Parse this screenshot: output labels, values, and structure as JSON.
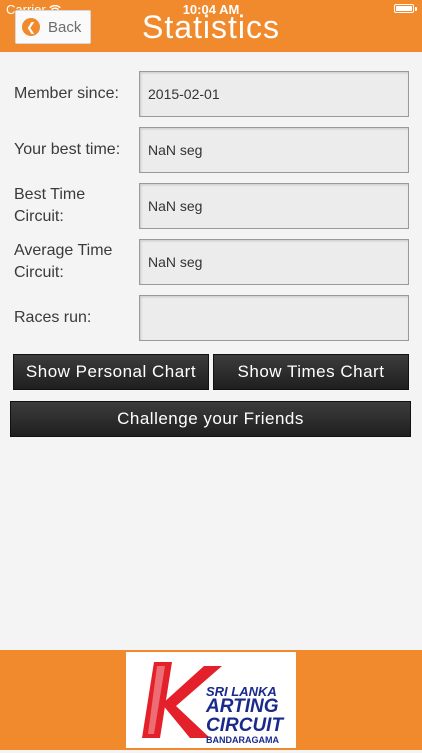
{
  "status_bar": {
    "carrier": "Carrier",
    "time": "10:04 AM"
  },
  "header": {
    "back_label": "Back",
    "title": "Statistics",
    "accent_color": "#f08a2c"
  },
  "fields": [
    {
      "label": "Member since:",
      "value": "2015-02-01"
    },
    {
      "label": "Your best time:",
      "value": "NaN seg"
    },
    {
      "label": "Best Time Circuit:",
      "value": "NaN seg"
    },
    {
      "label": "Average Time Circuit:",
      "value": "NaN seg"
    },
    {
      "label": "Races run:",
      "value": ""
    }
  ],
  "buttons": {
    "personal_chart": "Show Personal Chart",
    "times_chart": "Show Times Chart",
    "challenge": "Challenge your Friends"
  },
  "footer_logo": {
    "line1": "SRI LANKA",
    "line2": "ARTING",
    "line3": "CIRCUIT",
    "line4": "BANDARAGAMA",
    "brand_red": "#e4202a",
    "brand_blue": "#1a2a8a"
  }
}
